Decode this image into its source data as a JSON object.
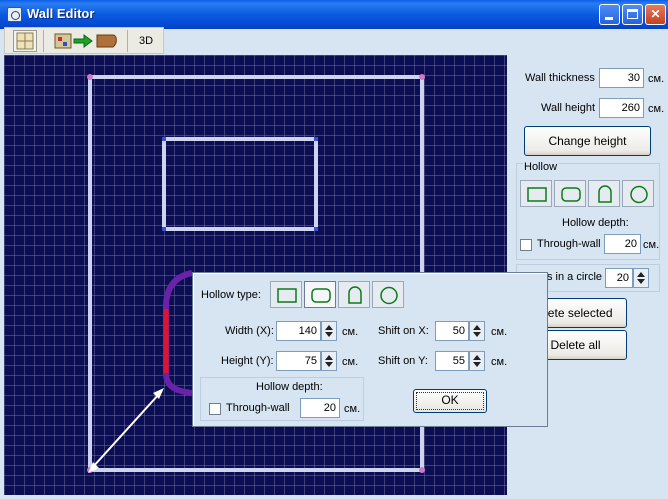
{
  "window": {
    "title": "Wall Editor",
    "buttons": [
      "minimize",
      "maximize",
      "close"
    ]
  },
  "toolbar": {
    "view3d_label": "3D",
    "icons": [
      "grid-icon",
      "export-walls-icon",
      "room-icon"
    ]
  },
  "right_panel": {
    "wall_thickness": {
      "label": "Wall thickness",
      "value": "30",
      "unit": "cм."
    },
    "wall_height": {
      "label": "Wall height",
      "value": "260",
      "unit": "cм."
    },
    "change_height_label": "Change height",
    "hollow": {
      "title": "Hollow",
      "shapes": [
        "rectangle",
        "rounded-rectangle",
        "arch",
        "circle"
      ],
      "depth_title": "Hollow depth:",
      "through_wall_label": "Through-wall",
      "through_wall_checked": false,
      "depth_value": "20",
      "depth_unit": "cм."
    },
    "points_label": "s in a circle",
    "points_value": "20",
    "delete_selected_label": "elete selected",
    "delete_all_label": "Delete all"
  },
  "dialog": {
    "hollow_type_label": "Hollow type:",
    "selected_shape": "rounded-rectangle",
    "width": {
      "label": "Width (X):",
      "value": "140",
      "unit": "cм."
    },
    "height": {
      "label": "Height (Y):",
      "value": "75",
      "unit": "cм."
    },
    "shift_x": {
      "label": "Shift on X:",
      "value": "50",
      "unit": "cм."
    },
    "shift_y": {
      "label": "Shift on Y:",
      "value": "55",
      "unit": "cм."
    },
    "depth_title": "Hollow depth:",
    "through_wall_label": "Through-wall",
    "through_wall_checked": false,
    "depth_value": "20",
    "depth_unit": "cм.",
    "ok_label": "OK"
  },
  "colors": {
    "canvas_bg": "#0b0e52",
    "wall": "#cfd4ee",
    "selected_wall": "#e0142c",
    "accent": "#2a7cf0"
  }
}
